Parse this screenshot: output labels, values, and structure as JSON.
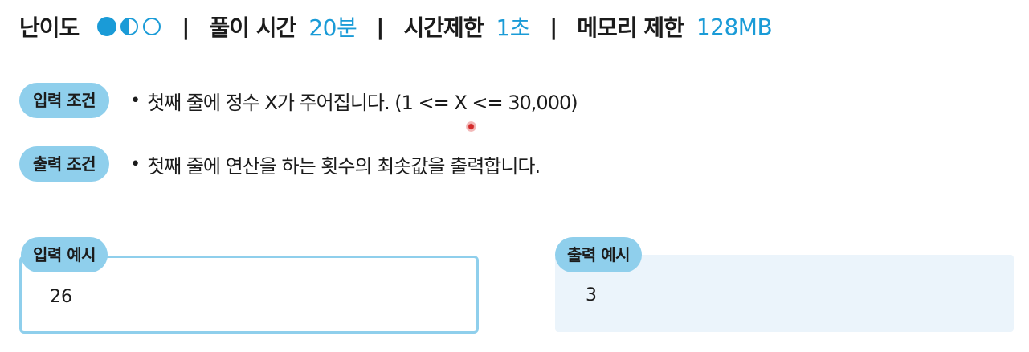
{
  "header": {
    "difficulty_label": "난이도",
    "difficulty_level": 1.5,
    "difficulty_max": 3,
    "separator": "|",
    "solve_time_label": "풀이 시간",
    "solve_time_value": "20분",
    "time_limit_label": "시간제한",
    "time_limit_value": "1초",
    "memory_limit_label": "메모리 제한",
    "memory_limit_value": "128MB"
  },
  "conditions": {
    "input": {
      "label": "입력 조건",
      "bullet": "•",
      "text": "첫째 줄에 정수 X가 주어집니다. (1 <= X <= 30,000)"
    },
    "output": {
      "label": "출력 조건",
      "bullet": "•",
      "text": "첫째 줄에 연산을 하는 횟수의 최솟값을 출력합니다."
    }
  },
  "examples": {
    "input": {
      "label": "입력 예시",
      "value": "26"
    },
    "output": {
      "label": "출력 예시",
      "value": "3"
    }
  },
  "colors": {
    "accent": "#1a9bd7",
    "pill": "#8fcfec",
    "output_box_bg": "#ebf4fb",
    "text": "#1b1b1b"
  }
}
